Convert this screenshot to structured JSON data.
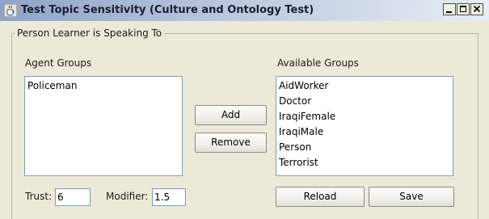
{
  "window": {
    "title": "Test Topic Sensitivity (Culture and Ontology Test)",
    "controls": [
      "minimize",
      "maximize",
      "close"
    ]
  },
  "panel": {
    "legend": "Person Learner is Speaking To"
  },
  "agent_groups": {
    "label": "Agent Groups",
    "items": [
      "Policeman"
    ]
  },
  "available_groups": {
    "label": "Available Groups",
    "items": [
      "AidWorker",
      "Doctor",
      "IraqiFemale",
      "IraqiMale",
      "Person",
      "Terrorist"
    ]
  },
  "buttons": {
    "add": "Add",
    "remove": "Remove",
    "reload": "Reload",
    "save": "Save"
  },
  "trust": {
    "label": "Trust:",
    "value": "6"
  },
  "modifier": {
    "label": "Modifier:",
    "value": "1.5"
  },
  "icons": {
    "app": "java-cup-icon",
    "minimize": "minimize-icon",
    "maximize": "maximize-icon",
    "close": "close-icon"
  }
}
